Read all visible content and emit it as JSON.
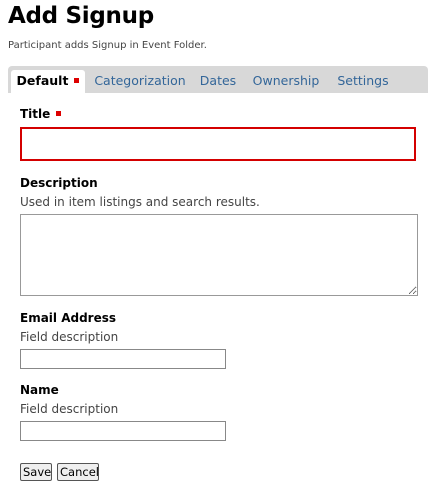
{
  "page": {
    "title": "Add Signup",
    "description": "Participant adds Signup in Event Folder."
  },
  "tabs": [
    {
      "label": "Default",
      "active": true,
      "required": true
    },
    {
      "label": "Categorization"
    },
    {
      "label": "Dates"
    },
    {
      "label": "Ownership"
    },
    {
      "label": "Settings"
    }
  ],
  "fields": {
    "title": {
      "label": "Title",
      "required": true,
      "value": ""
    },
    "description": {
      "label": "Description",
      "help": "Used in item listings and search results.",
      "value": ""
    },
    "email": {
      "label": "Email Address",
      "help": "Field description",
      "value": ""
    },
    "name": {
      "label": "Name",
      "help": "Field description",
      "value": ""
    }
  },
  "buttons": {
    "save": "Save",
    "cancel": "Cancel"
  },
  "colors": {
    "link": "#336699",
    "required": "#dd0000",
    "tabbar": "#d8d8d8"
  }
}
